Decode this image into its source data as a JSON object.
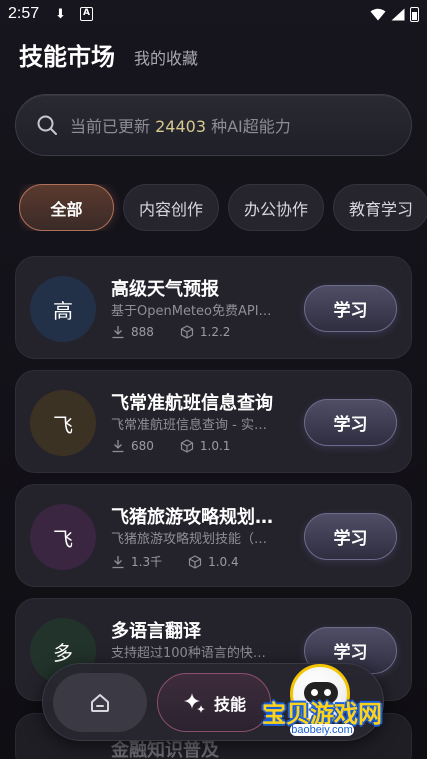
{
  "status_bar": {
    "time": "2:57",
    "icons": [
      "download-icon",
      "a-icon",
      "wifi-icon",
      "signal-icon",
      "battery-icon"
    ]
  },
  "header": {
    "title": "技能市场",
    "favorites_tab": "我的收藏"
  },
  "search": {
    "prefix": "当前已更新",
    "count": "24403",
    "suffix": "种AI超能力",
    "accent_color": "#d8c98f"
  },
  "categories": [
    {
      "label": "全部",
      "active": true
    },
    {
      "label": "内容创作",
      "active": false
    },
    {
      "label": "办公协作",
      "active": false
    },
    {
      "label": "教育学习",
      "active": false
    }
  ],
  "skills": [
    {
      "avatar": "高",
      "avatar_color": "#223148",
      "title": "高级天气预报",
      "desc": "基于OpenMeteo免费API…",
      "downloads": "888",
      "version": "1.2.2",
      "button": "学习"
    },
    {
      "avatar": "飞",
      "avatar_color": "#3b3224",
      "title": "飞常准航班信息查询",
      "desc": "飞常准航班信息查询 - 实…",
      "downloads": "680",
      "version": "1.0.1",
      "button": "学习"
    },
    {
      "avatar": "飞",
      "avatar_color": "#3a2640",
      "title": "飞猪旅游攻略规划…",
      "desc": "飞猪旅游攻略规划技能（…",
      "downloads": "1.3千",
      "version": "1.0.4",
      "button": "学习"
    },
    {
      "avatar": "多",
      "avatar_color": "#22332b",
      "title": "多语言翻译",
      "desc": "支持超过100种语言的快…",
      "downloads": "",
      "version": "",
      "button": "学习"
    }
  ],
  "partial_card": {
    "title": "金融知识普及"
  },
  "bottom_nav": {
    "home_icon": "home-icon",
    "skill_label": "技能",
    "skill_icon": "sparkle-icon"
  },
  "watermark": {
    "text": "宝贝游戏网",
    "url": "baobeiy.com"
  }
}
